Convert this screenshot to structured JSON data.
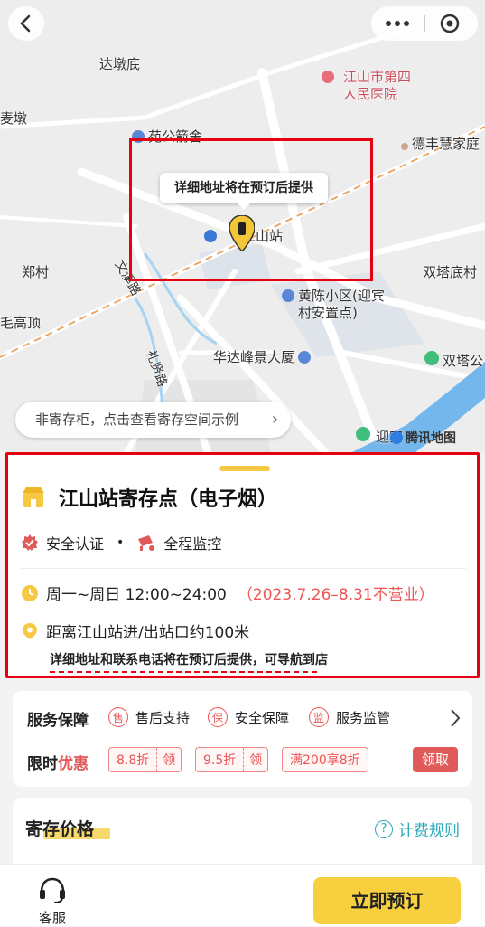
{
  "map": {
    "tooltip": "详细地址将在预订后提供",
    "cabinet_tip": "非寄存柜，点击查看寄存空间示例",
    "attribution": "腾讯地图",
    "labels": {
      "dadundi": "达墩底",
      "hospital": "江山市第四\n人民医院",
      "maidun": "麦墩",
      "yuangong": "苑公箭舍",
      "defeng": "德丰慧家庭",
      "station": "江山站",
      "zhengcun": "郑村",
      "shuangta": "双塔底村",
      "huangchen": "黄陈小区(迎宾\n村安置点)",
      "gaoding": "毛高顶",
      "huada": "华达峰景大厦",
      "shuangta2": "双塔公",
      "yibin": "迎宾",
      "wenxi": "文溪路",
      "lixian": "礼贤路"
    }
  },
  "store": {
    "title": "江山站寄存点（电子烟）",
    "badge_safe": "安全认证",
    "badge_monitor": "全程监控",
    "hours": "周一~周日 12:00~24:00",
    "closed_note": "（2023.7.26–8.31不营业）",
    "distance": "距离江山站进/出站口约100米",
    "address_note": "详细地址和联系电话将在预订后提供，可导航到店"
  },
  "service": {
    "label": "服务保障",
    "items": [
      {
        "icon": "售",
        "text": "售后支持"
      },
      {
        "icon": "保",
        "text": "安全保障"
      },
      {
        "icon": "监",
        "text": "服务监管"
      }
    ],
    "promo_label_a": "限时",
    "promo_label_b": "优惠",
    "coupons": [
      {
        "value": "8.8折",
        "action": "领"
      },
      {
        "value": "9.5折",
        "action": "领"
      },
      {
        "value": "满200享8折",
        "action": ""
      }
    ],
    "claim": "领取"
  },
  "price": {
    "title": "寄存价格",
    "rules": "计费规则"
  },
  "bottom": {
    "customer_service": "客服",
    "book": "立即预订"
  },
  "colors": {
    "accent": "#f7cf3f",
    "red": "#e05a5a",
    "teal": "#2aa9b8"
  }
}
